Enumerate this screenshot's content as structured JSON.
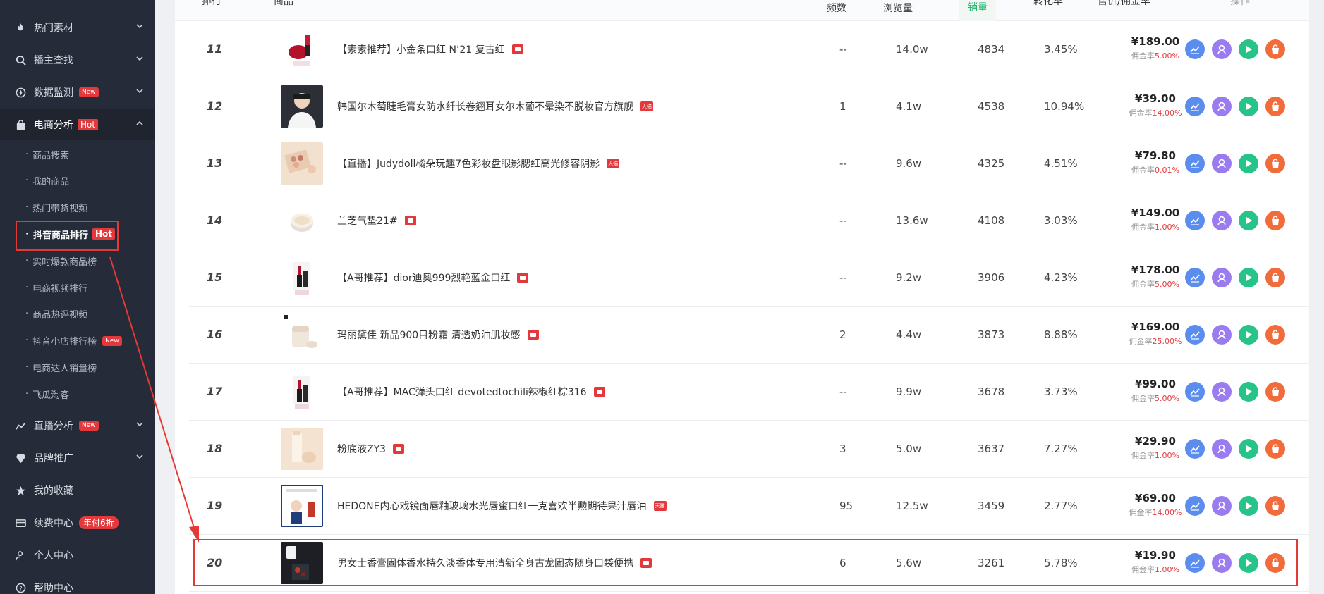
{
  "sidebar": {
    "items": [
      {
        "label": "热门素材",
        "icon": "fire-icon",
        "caret": true
      },
      {
        "label": "播主查找",
        "icon": "search-icon",
        "caret": true
      },
      {
        "label": "数据监测",
        "icon": "compass-icon",
        "badge": "New",
        "caret": true
      },
      {
        "label": "电商分析",
        "icon": "bag-icon",
        "badge": "Hot",
        "caret": true,
        "expanded": true
      },
      {
        "label": "直播分析",
        "icon": "chart-line-icon",
        "badge": "New",
        "caret": true
      },
      {
        "label": "品牌推广",
        "icon": "diamond-icon",
        "caret": true
      },
      {
        "label": "我的收藏",
        "icon": "star-icon"
      },
      {
        "label": "续费中心",
        "icon": "card-icon",
        "promo": "年付6折"
      },
      {
        "label": "个人中心",
        "icon": "user-icon"
      },
      {
        "label": "帮助中心",
        "icon": "help-icon"
      }
    ],
    "sub_items": [
      {
        "label": "商品搜索"
      },
      {
        "label": "我的商品"
      },
      {
        "label": "热门带货视频"
      },
      {
        "label": "抖音商品排行",
        "badge": "Hot",
        "current": true
      },
      {
        "label": "实时爆款商品榜"
      },
      {
        "label": "电商视频排行"
      },
      {
        "label": "商品热评视频"
      },
      {
        "label": "抖音小店排行榜",
        "badge": "New"
      },
      {
        "label": "电商达人销量榜"
      },
      {
        "label": "飞瓜淘客"
      }
    ]
  },
  "table": {
    "headers": {
      "rank": "排行",
      "product": "商品",
      "freq": "频数",
      "views": "浏览量",
      "sales": "销量",
      "conversion": "转化率",
      "price": "售价/佣金率",
      "ops": "操作"
    },
    "commission_label": "佣金率",
    "rows": [
      {
        "rank": "11",
        "name": "【素素推荐】小金条口红 N’21 复古红",
        "shop": "shop",
        "freq": "--",
        "views": "14.0w",
        "sales": "4834",
        "conversion": "3.45%",
        "price": "¥189.00",
        "commission": "5.00%",
        "thumb": "lipstick-red"
      },
      {
        "rank": "12",
        "name": "韩国尔木萄睫毛膏女防水纤长卷翘耳女尔木葡不晕染不脱妆官方旗舰",
        "shop": "天猫",
        "freq": "1",
        "views": "4.1w",
        "sales": "4538",
        "conversion": "10.94%",
        "price": "¥39.00",
        "commission": "14.00%",
        "thumb": "person"
      },
      {
        "rank": "13",
        "name": "【直播】Judydoll橘朵玩趣7色彩妆盘眼影腮红高光修容阴影",
        "shop": "天猫",
        "freq": "--",
        "views": "9.6w",
        "sales": "4325",
        "conversion": "4.51%",
        "price": "¥79.80",
        "commission": "0.01%",
        "thumb": "palette"
      },
      {
        "rank": "14",
        "name": "兰芝气垫21#",
        "shop": "shop",
        "freq": "--",
        "views": "13.6w",
        "sales": "4108",
        "conversion": "3.03%",
        "price": "¥149.00",
        "commission": "1.00%",
        "thumb": "cushion"
      },
      {
        "rank": "15",
        "name": "【A哥推荐】dior迪奥999烈艳蓝金口红",
        "shop": "shop",
        "freq": "--",
        "views": "9.2w",
        "sales": "3906",
        "conversion": "4.23%",
        "price": "¥178.00",
        "commission": "5.00%",
        "thumb": "lipstick-dark"
      },
      {
        "rank": "16",
        "name": "玛丽黛佳 新品900目粉霜 清透奶油肌妆感",
        "shop": "shop",
        "freq": "2",
        "views": "4.4w",
        "sales": "3873",
        "conversion": "8.88%",
        "price": "¥169.00",
        "commission": "25.00%",
        "thumb": "cream"
      },
      {
        "rank": "17",
        "name": "【A哥推荐】MAC弹头口红 devotedtochili辣椒红棕316",
        "shop": "shop",
        "freq": "--",
        "views": "9.9w",
        "sales": "3678",
        "conversion": "3.73%",
        "price": "¥99.00",
        "commission": "5.00%",
        "thumb": "lipstick-dark"
      },
      {
        "rank": "18",
        "name": "粉底液ZY3",
        "shop": "shop",
        "freq": "3",
        "views": "5.0w",
        "sales": "3637",
        "conversion": "7.27%",
        "price": "¥29.90",
        "commission": "1.00%",
        "thumb": "foundation"
      },
      {
        "rank": "19",
        "name": "HEDONE内心戏镜面唇釉玻璃水光唇蜜口红一克喜欢半勲期待果汁唇油",
        "shop": "天猫",
        "freq": "95",
        "views": "12.5w",
        "sales": "3459",
        "conversion": "2.77%",
        "price": "¥69.00",
        "commission": "14.00%",
        "thumb": "poster"
      },
      {
        "rank": "20",
        "name": "男女士香膏固体香水持久淡香体专用清新全身古龙固态随身口袋便携",
        "shop": "shop",
        "freq": "6",
        "views": "5.6w",
        "sales": "3261",
        "conversion": "5.78%",
        "price": "¥19.90",
        "commission": "1.00%",
        "thumb": "dark-product"
      }
    ]
  },
  "colors": {
    "sidebar_bg": "#262b3a",
    "accent_red": "#e4393c",
    "sales_green": "#1cb46b",
    "op_trend": "#5b8def",
    "op_user": "#9a7cf0",
    "op_play": "#27c48a",
    "op_shop": "#f26b3a"
  }
}
